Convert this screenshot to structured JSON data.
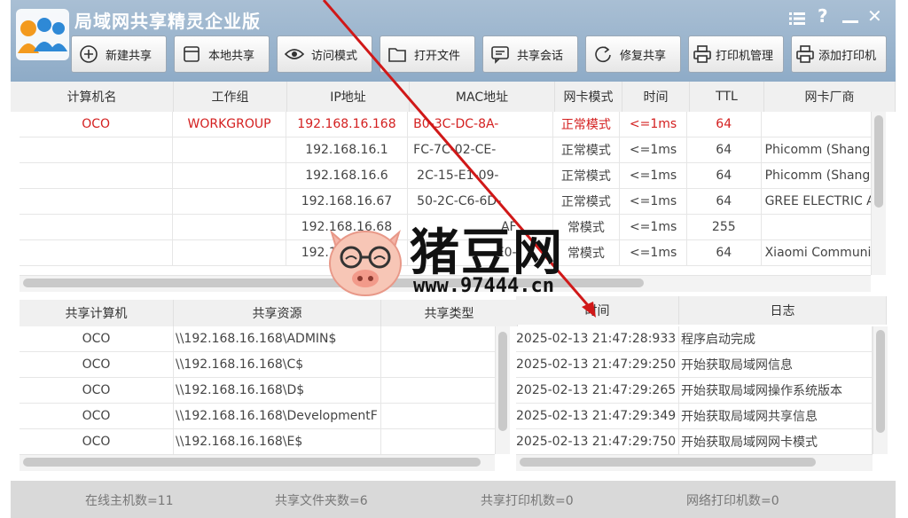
{
  "app": {
    "title": "局域网共享精灵企业版",
    "logo_icon": "people-group-logo-icon",
    "window_controls": [
      "menu-icon",
      "help-icon",
      "minimize-icon",
      "close-icon"
    ],
    "help_glyph": "?",
    "close_glyph": "✕"
  },
  "toolbar": {
    "buttons": [
      {
        "label": "新建共享",
        "icon": "plus-circle-icon"
      },
      {
        "label": "本地共享",
        "icon": "window-icon"
      },
      {
        "label": "访问模式",
        "icon": "eye-icon"
      },
      {
        "label": "打开文件",
        "icon": "folder-icon"
      },
      {
        "label": "共享会话",
        "icon": "chat-icon"
      },
      {
        "label": "修复共享",
        "icon": "refresh-icon"
      },
      {
        "label": "打印机管理",
        "icon": "printer-icon"
      },
      {
        "label": "添加打印机",
        "icon": "printer-add-icon"
      }
    ]
  },
  "hosts": {
    "columns": [
      "计算机名",
      "工作组",
      "IP地址",
      "MAC地址",
      "网卡模式",
      "时间",
      "TTL",
      "网卡厂商"
    ],
    "rows": [
      {
        "name": "OCO",
        "group": "WORKGROUP",
        "ip": "192.168.16.168",
        "mac": "B0-3C-DC-8A-",
        "mode": "正常模式",
        "time": "<=1ms",
        "ttl": "64",
        "vendor": "",
        "highlight": true
      },
      {
        "name": "",
        "group": "",
        "ip": "192.168.16.1",
        "mac": "FC-7C-02-CE-",
        "mode": "正常模式",
        "time": "<=1ms",
        "ttl": "64",
        "vendor": "Phicomm (Shang"
      },
      {
        "name": "",
        "group": "",
        "ip": "192.168.16.6",
        "mac": "2C-15-E1-09-",
        "mode": "正常模式",
        "time": "<=1ms",
        "ttl": "64",
        "vendor": "Phicomm (Shang"
      },
      {
        "name": "",
        "group": "",
        "ip": "192.168.16.67",
        "mac": "50-2C-C6-6D-",
        "mode": "正常模式",
        "time": "<=1ms",
        "ttl": "64",
        "vendor": "GREE ELECTRIC A"
      },
      {
        "name": "",
        "group": "",
        "ip": "192.168.16.68",
        "mac": "AF",
        "mode": "常模式",
        "time": "<=1ms",
        "ttl": "255",
        "vendor": ""
      },
      {
        "name": "",
        "group": "",
        "ip": "192.168.16.69",
        "mac": "E0-",
        "mode": "常模式",
        "time": "<=1ms",
        "ttl": "64",
        "vendor": "Xiaomi Communi"
      }
    ]
  },
  "shares": {
    "columns": [
      "共享计算机",
      "共享资源",
      "共享类型"
    ],
    "rows": [
      {
        "computer": "OCO",
        "resource": "\\\\192.168.16.168\\ADMIN$",
        "type": ""
      },
      {
        "computer": "OCO",
        "resource": "\\\\192.168.16.168\\C$",
        "type": ""
      },
      {
        "computer": "OCO",
        "resource": "\\\\192.168.16.168\\D$",
        "type": ""
      },
      {
        "computer": "OCO",
        "resource": "\\\\192.168.16.168\\DevelopmentF",
        "type": ""
      },
      {
        "computer": "OCO",
        "resource": "\\\\192.168.16.168\\E$",
        "type": ""
      }
    ]
  },
  "log": {
    "columns": [
      "时间",
      "日志"
    ],
    "rows": [
      {
        "time": "2025-02-13 21:47:28:933",
        "message": "程序启动完成"
      },
      {
        "time": "2025-02-13 21:47:29:250",
        "message": "开始获取局域网信息"
      },
      {
        "time": "2025-02-13 21:47:29:265",
        "message": "开始获取局域网操作系统版本"
      },
      {
        "time": "2025-02-13 21:47:29:349",
        "message": "开始获取局域网共享信息"
      },
      {
        "time": "2025-02-13 21:47:29:750",
        "message": "开始获取局域网网卡模式"
      }
    ]
  },
  "status": {
    "online_hosts": "在线主机数=11",
    "shared_folders": "共享文件夹数=6",
    "shared_printers": "共享打印机数=0",
    "network_printers": "网络打印机数=0"
  },
  "watermark": {
    "brand": "猪豆网",
    "url": "www.97444.cn",
    "icon": "pig-mascot-icon"
  },
  "colors": {
    "highlight_row": "#d42020",
    "titlebar": "#9bb4cd",
    "annotation_arrow": "#d01818"
  }
}
